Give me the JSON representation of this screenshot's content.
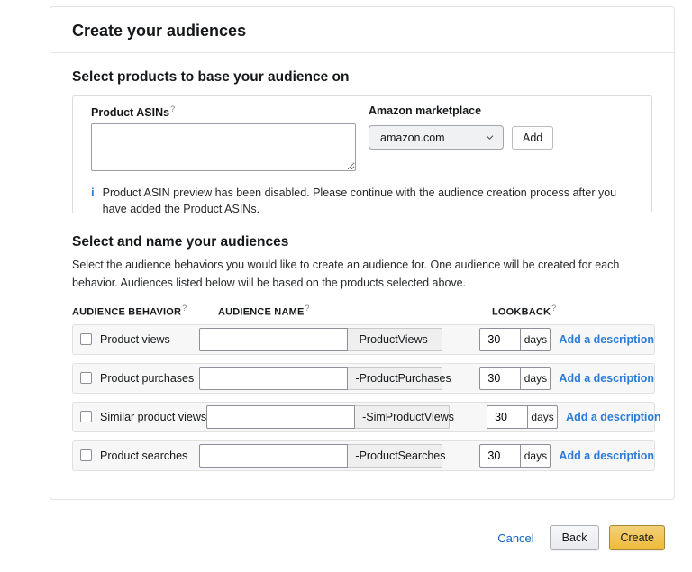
{
  "ui": {
    "help_mark": "?",
    "info_icon_glyph": "i",
    "colors": {
      "link_blue": "#2b7bd9",
      "cancel_blue": "#0f62c4",
      "create_gold": "#f0c14b",
      "create_border": "#a88734",
      "row_background": "#f7f7f7",
      "border_gray": "#dcdcdc"
    }
  },
  "page": {
    "title": "Create your audiences"
  },
  "products_section": {
    "heading": "Select products to base your audience on",
    "asin_label": "Product ASINs",
    "asin_value": "",
    "marketplace_label": "Amazon marketplace",
    "marketplace_value": "amazon.com",
    "add_button_label": "Add",
    "info_text": "Product ASIN preview has been disabled. Please continue with the audience creation process after you have added the Product ASINs."
  },
  "audiences_section": {
    "heading": "Select and name your audiences",
    "description": "Select the audience behaviors you would like to create an audience for. One audience will be created for each behavior. Audiences listed below will be based on the products selected above.",
    "columns": {
      "behavior": "AUDIENCE BEHAVIOR",
      "name": "AUDIENCE NAME",
      "lookback": "LOOKBACK"
    },
    "rows": [
      {
        "behavior": "Product views",
        "name_value": "",
        "name_suffix": "-ProductViews",
        "lookback": "30",
        "unit": "days",
        "action": "Add a description"
      },
      {
        "behavior": "Product purchases",
        "name_value": "",
        "name_suffix": "-ProductPurchases",
        "lookback": "30",
        "unit": "days",
        "action": "Add a description"
      },
      {
        "behavior": "Similar product views",
        "name_value": "",
        "name_suffix": "-SimProductViews",
        "lookback": "30",
        "unit": "days",
        "action": "Add a description"
      },
      {
        "behavior": "Product searches",
        "name_value": "",
        "name_suffix": "-ProductSearches",
        "lookback": "30",
        "unit": "days",
        "action": "Add a description"
      }
    ]
  },
  "footer": {
    "cancel_label": "Cancel",
    "back_label": "Back",
    "create_label": "Create"
  }
}
